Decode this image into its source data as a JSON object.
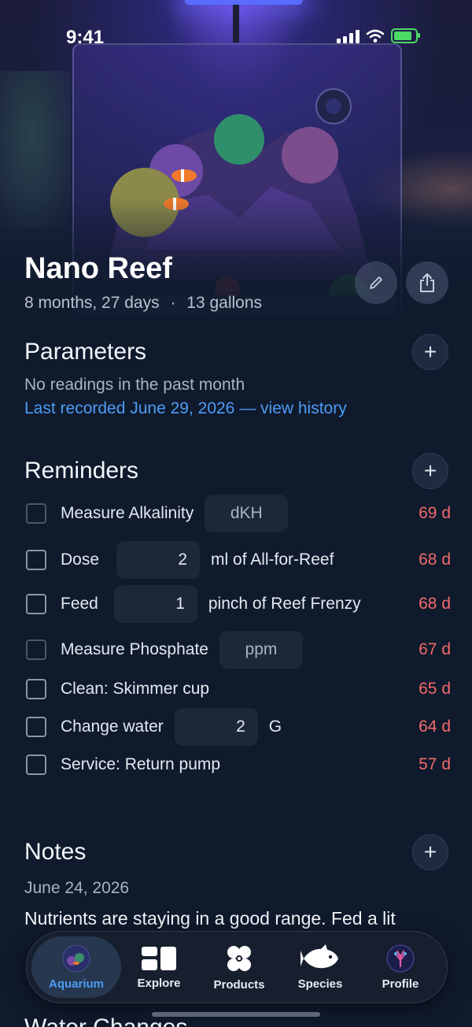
{
  "status_bar": {
    "time": "9:41"
  },
  "hero": {
    "title": "Nano Reef",
    "age": "8 months, 27 days",
    "separator": "·",
    "volume": "13 gallons",
    "edit_icon": "pencil-icon",
    "share_icon": "share-icon"
  },
  "parameters": {
    "title": "Parameters",
    "empty_text": "No readings in the past month",
    "history_link": "Last recorded June 29, 2026 — view history"
  },
  "reminders": {
    "title": "Reminders",
    "items": [
      {
        "label": "Measure Alkalinity",
        "input": "dKH",
        "after": "",
        "due": "69 d"
      },
      {
        "label": "Dose",
        "input": "2",
        "after": "ml of All-for-Reef",
        "due": "68 d"
      },
      {
        "label": "Feed",
        "input": "1",
        "after": "pinch of Reef Frenzy",
        "due": "68 d"
      },
      {
        "label": "Measure Phosphate",
        "input": "ppm",
        "after": "",
        "due": "67 d"
      },
      {
        "label": "Clean: Skimmer cup",
        "input": "",
        "after": "",
        "due": "65 d"
      },
      {
        "label": "Change water",
        "input": "2",
        "after": "G",
        "due": "64 d"
      },
      {
        "label": "Service: Return pump",
        "input": "",
        "after": "",
        "due": "57 d"
      }
    ]
  },
  "notes": {
    "title": "Notes",
    "date": "June 24, 2026",
    "text": "Nutrients are staying in a good range. Fed a lit"
  },
  "next_section": {
    "title": "Water Changes"
  },
  "tabbar": {
    "tabs": [
      {
        "label": "Aquarium",
        "icon": "aquarium-avatar-icon"
      },
      {
        "label": "Explore",
        "icon": "grid-icon"
      },
      {
        "label": "Products",
        "icon": "fan-icon"
      },
      {
        "label": "Species",
        "icon": "fish-icon"
      },
      {
        "label": "Profile",
        "icon": "profile-avatar-icon"
      }
    ]
  },
  "colors": {
    "accent": "#4d9cf5",
    "overdue": "#f06b6b",
    "background": "#0f1a2c"
  }
}
